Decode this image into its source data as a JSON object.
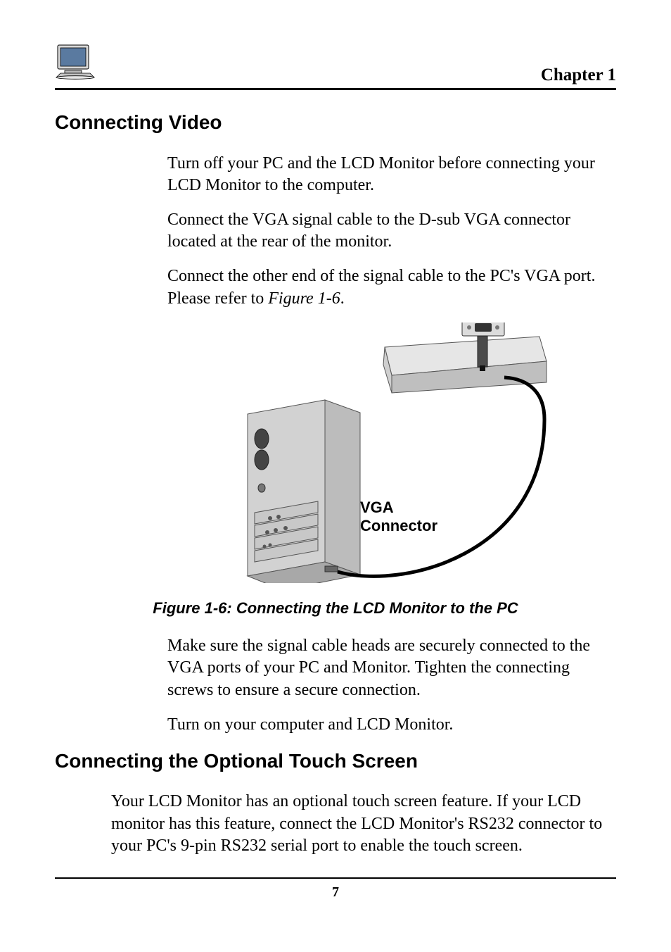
{
  "header": {
    "chapter": "Chapter 1"
  },
  "section1": {
    "title": "Connecting Video",
    "p1": "Turn off your PC and the LCD Monitor before connecting your LCD Monitor to the computer.",
    "p2": "Connect the VGA signal cable to the D-sub VGA connector located at the rear of the monitor.",
    "p3a": "Connect the other end of the signal cable to the PC's VGA port.  Please refer to ",
    "p3ref": "Figure 1-6",
    "p3b": ".",
    "figure_label_line1": "VGA",
    "figure_label_line2": "Connector",
    "figure_caption": "Figure 1-6: Connecting the LCD Monitor to the PC",
    "p4": "Make sure the signal cable heads are securely connected to the VGA ports of your PC and Monitor.  Tighten the connecting screws to ensure a secure connection.",
    "p5": "Turn on your computer and LCD Monitor."
  },
  "section2": {
    "title": "Connecting the Optional Touch Screen",
    "p1": "Your LCD Monitor has an optional touch screen feature.  If your LCD monitor has this feature, connect the LCD Monitor's RS232 connector to your PC's 9-pin RS232 serial port to enable the touch screen."
  },
  "footer": {
    "page_number": "7"
  }
}
